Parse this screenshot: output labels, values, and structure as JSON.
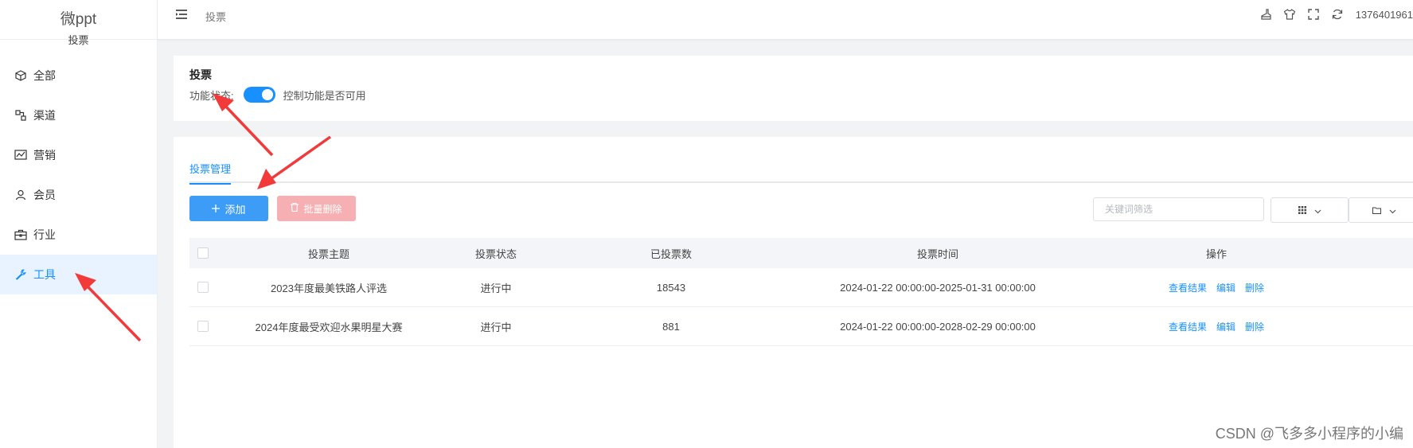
{
  "brand": {
    "name": "微ppt",
    "subtitle": "投票"
  },
  "sidebar": {
    "items": [
      {
        "label": "全部",
        "icon": "cube-icon",
        "active": false
      },
      {
        "label": "渠道",
        "icon": "channel-icon",
        "active": false
      },
      {
        "label": "营销",
        "icon": "chart-line-icon",
        "active": false
      },
      {
        "label": "会员",
        "icon": "user-icon",
        "active": false
      },
      {
        "label": "行业",
        "icon": "briefcase-icon",
        "active": false
      },
      {
        "label": "工具",
        "icon": "wrench-icon",
        "active": true
      }
    ]
  },
  "header": {
    "breadcrumb": "投票",
    "user": "1376401961",
    "icons": [
      "broom-icon",
      "shirt-icon",
      "fullscreen-icon",
      "refresh-icon"
    ]
  },
  "feature": {
    "title": "投票",
    "status_label": "功能状态:",
    "switch_on": true,
    "description": "控制功能是否可用"
  },
  "tabs": [
    {
      "label": "投票管理",
      "active": true
    }
  ],
  "toolbar": {
    "add_label": "添加",
    "batch_delete_label": "批量删除",
    "search_placeholder": "关键词筛选"
  },
  "table": {
    "columns": [
      "投票主题",
      "投票状态",
      "已投票数",
      "投票时间",
      "操作"
    ],
    "rows": [
      {
        "topic": "2023年度最美铁路人评选",
        "status": "进行中",
        "count": "18543",
        "time": "2024-01-22 00:00:00-2025-01-31 00:00:00"
      },
      {
        "topic": "2024年度最受欢迎水果明星大赛",
        "status": "进行中",
        "count": "881",
        "time": "2024-01-22 00:00:00-2028-02-29 00:00:00"
      }
    ],
    "actions": {
      "view": "查看结果",
      "edit": "编辑",
      "delete": "删除"
    }
  },
  "watermark": "CSDN @飞多多小程序的小编",
  "colors": {
    "primary": "#1890ff",
    "danger_disabled": "#f6b0b3",
    "arrow": "#f23a3a"
  }
}
